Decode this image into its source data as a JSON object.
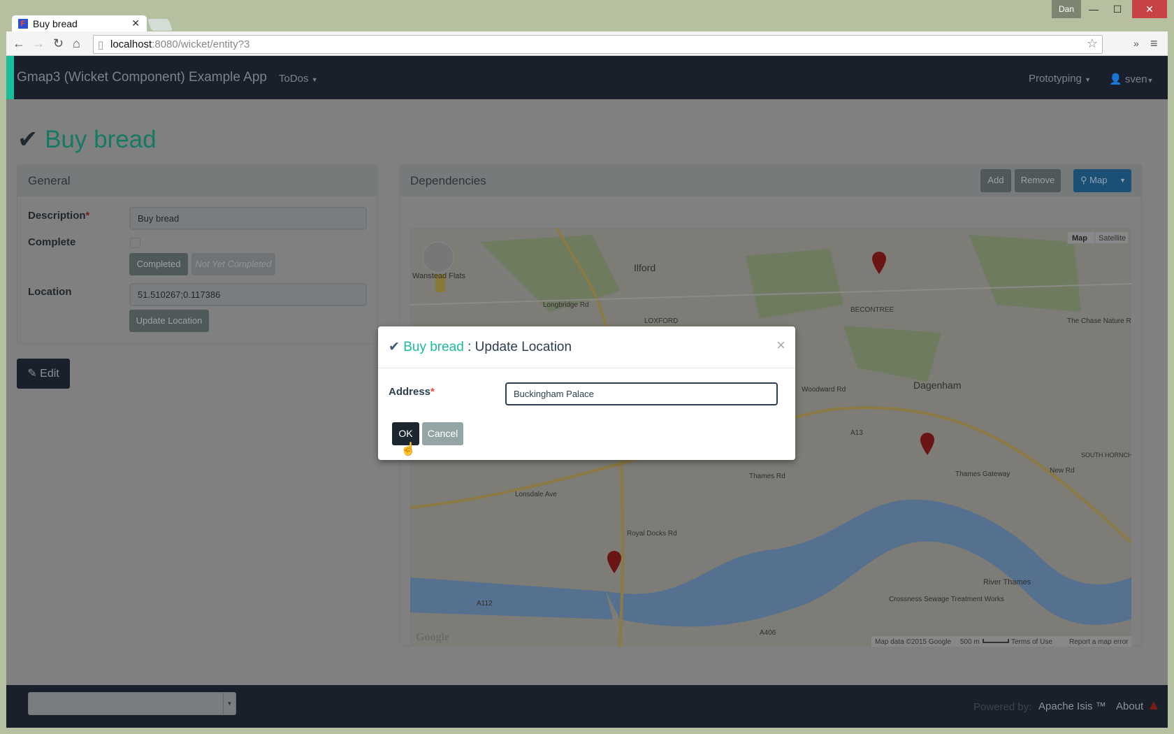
{
  "browser": {
    "tab_title": "Buy bread",
    "user_badge": "Dan",
    "url_host": "localhost",
    "url_rest": ":8080/wicket/entity?3"
  },
  "navbar": {
    "brand": "Gmap3 (Wicket Component) Example App",
    "menu_todos": "ToDos",
    "menu_prototyping": "Prototyping",
    "menu_user": "sven"
  },
  "page": {
    "title": "Buy bread",
    "edit_label": "Edit"
  },
  "general": {
    "heading": "General",
    "description_label": "Description",
    "description_value": "Buy bread",
    "complete_label": "Complete",
    "complete_checked": false,
    "completed_button": "Completed",
    "not_yet_completed_button": "Not Yet Completed",
    "location_label": "Location",
    "location_value": "51.510267;0.117386",
    "update_location_button": "Update Location"
  },
  "dependencies": {
    "heading": "Dependencies",
    "add_button": "Add",
    "remove_button": "Remove",
    "map_button": "Map"
  },
  "map": {
    "type_map": "Map",
    "type_satellite": "Satellite",
    "labels": [
      "Ilford",
      "Wanstead Flats",
      "LOXFORD",
      "BECONTREE",
      "Dagenham",
      "The Chase Nature Reserve",
      "SOUTH HORNCHURCH",
      "River Thames",
      "Crossness Sewage Treatment Works",
      "Longbridge Rd",
      "Woodward Rd",
      "Thames Rd",
      "Lonsdale Ave",
      "Royal Docks Rd",
      "New Rd",
      "Thames Gateway",
      "A13",
      "A112",
      "A406"
    ],
    "attribution": "Map data ©2015 Google",
    "scale": "500 m",
    "terms": "Terms of Use",
    "report": "Report a map error",
    "logo": "Google",
    "colors": {
      "land": "#7d7c76",
      "park": "#6e7b5f",
      "water": "#56708f",
      "road": "#8c7a45",
      "marker": "#6b1414"
    }
  },
  "modal": {
    "entity": "Buy bread",
    "separator": " : ",
    "action": "Update Location",
    "close": "×",
    "address_label": "Address",
    "address_value": "Buckingham Palace",
    "ok": "OK",
    "cancel": "Cancel"
  },
  "footer": {
    "powered_by": "Powered by:",
    "isis": "Apache Isis ™",
    "about": "About"
  },
  "colors": {
    "accent": "#1abc9c",
    "navbar": "#1a202b",
    "primary_dark": "#1a242f",
    "map_button": "#1c4f74",
    "warning": "#7a1c14"
  }
}
